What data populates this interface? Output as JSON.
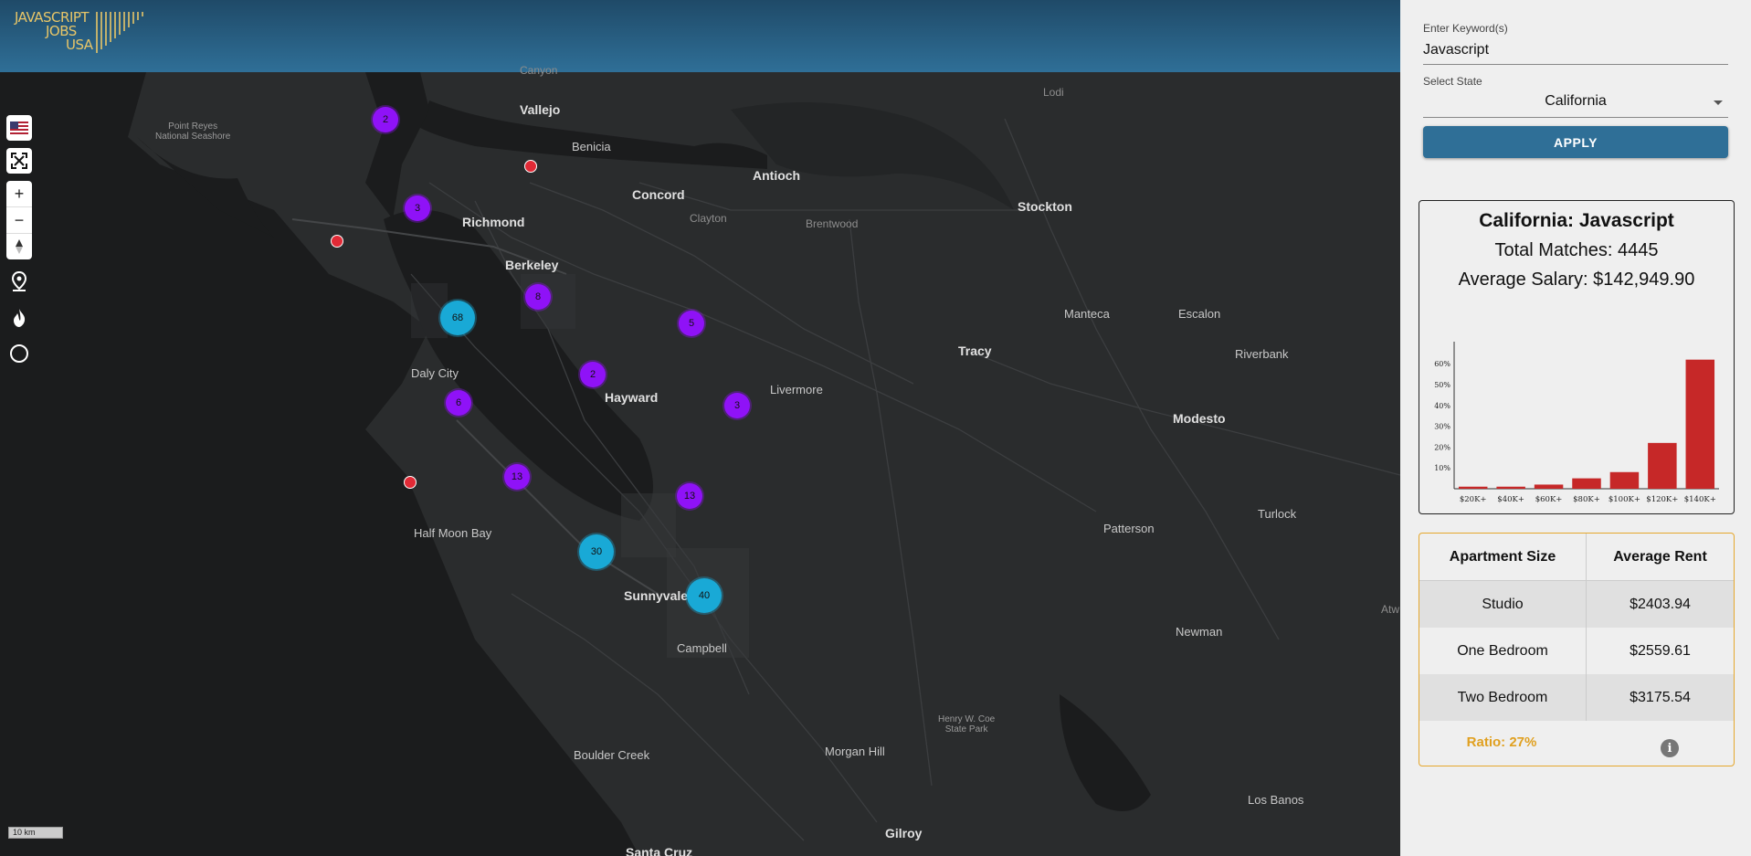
{
  "logo": {
    "line1": "JAVASCRIPT",
    "line2": "JOBS",
    "line3": "USA"
  },
  "map": {
    "places": [
      {
        "name": "Vallejo",
        "cls": "big"
      },
      {
        "name": "Benicia",
        "cls": ""
      },
      {
        "name": "Concord",
        "cls": "big"
      },
      {
        "name": "Antioch",
        "cls": "big"
      },
      {
        "name": "Clayton",
        "cls": "small"
      },
      {
        "name": "Brentwood",
        "cls": "small"
      },
      {
        "name": "Stockton",
        "cls": "big"
      },
      {
        "name": "Lodi",
        "cls": "small"
      },
      {
        "name": "Richmond",
        "cls": "big"
      },
      {
        "name": "Berkeley",
        "cls": "big"
      },
      {
        "name": "Daly City",
        "cls": ""
      },
      {
        "name": "Hayward",
        "cls": "big"
      },
      {
        "name": "Livermore",
        "cls": ""
      },
      {
        "name": "Tracy",
        "cls": "big"
      },
      {
        "name": "Manteca",
        "cls": ""
      },
      {
        "name": "Escalon",
        "cls": ""
      },
      {
        "name": "Riverbank",
        "cls": ""
      },
      {
        "name": "Modesto",
        "cls": "big"
      },
      {
        "name": "Half Moon Bay",
        "cls": ""
      },
      {
        "name": "Sunnyvale",
        "cls": "big"
      },
      {
        "name": "Campbell",
        "cls": ""
      },
      {
        "name": "Patterson",
        "cls": ""
      },
      {
        "name": "Turlock",
        "cls": ""
      },
      {
        "name": "Newman",
        "cls": ""
      },
      {
        "name": "Boulder Creek",
        "cls": ""
      },
      {
        "name": "Morgan Hill",
        "cls": ""
      },
      {
        "name": "Henry W. Coe\nState Park",
        "cls": "tiny"
      },
      {
        "name": "Los Banos",
        "cls": ""
      },
      {
        "name": "Gilroy",
        "cls": "big"
      },
      {
        "name": "Santa Cruz",
        "cls": "big"
      },
      {
        "name": "Point Reyes\nNational Seashore",
        "cls": "tiny"
      },
      {
        "name": "Canyon",
        "cls": "small"
      },
      {
        "name": "Atw",
        "cls": "small"
      }
    ],
    "clusters": [
      {
        "count": "2",
        "kind": "p"
      },
      {
        "count": "3",
        "kind": "p"
      },
      {
        "count": "8",
        "kind": "p"
      },
      {
        "count": "68",
        "kind": "c"
      },
      {
        "count": "5",
        "kind": "p"
      },
      {
        "count": "2",
        "kind": "p"
      },
      {
        "count": "6",
        "kind": "p"
      },
      {
        "count": "3",
        "kind": "p"
      },
      {
        "count": "13",
        "kind": "p"
      },
      {
        "count": "13",
        "kind": "p"
      },
      {
        "count": "30",
        "kind": "c"
      },
      {
        "count": "40",
        "kind": "c"
      }
    ],
    "scale_label": "10 km",
    "colors": {
      "cluster_small": "#8f12f7",
      "cluster_large": "#19a9d6",
      "job_pin": "#e12a36"
    }
  },
  "search": {
    "keyword_label": "Enter Keyword(s)",
    "keyword_value": "Javascript",
    "state_label": "Select State",
    "state_value": "California",
    "apply_label": "APPLY"
  },
  "summary": {
    "title": "California: Javascript",
    "total_matches": "Total Matches: 4445",
    "avg_salary": "Average Salary: $142,949.90"
  },
  "chart_data": {
    "type": "bar",
    "categories": [
      "$20K+",
      "$40K+",
      "$60K+",
      "$80K+",
      "$100K+",
      "$120K+",
      "$140K+"
    ],
    "values": [
      1,
      1,
      2,
      5,
      8,
      22,
      62
    ],
    "yticks": [
      "10%",
      "20%",
      "30%",
      "40%",
      "50%",
      "60%"
    ],
    "ylim": [
      0,
      68
    ],
    "bar_color": "#c62828"
  },
  "rent": {
    "headers": [
      "Apartment Size",
      "Average Rent"
    ],
    "rows": [
      {
        "size": "Studio",
        "rent": "$2403.94"
      },
      {
        "size": "One Bedroom",
        "rent": "$2559.61"
      },
      {
        "size": "Two Bedroom",
        "rent": "$3175.54"
      }
    ],
    "ratio": "Ratio: 27%",
    "info_glyph": "i"
  },
  "icons": {
    "flag": "flag-icon",
    "fullscreen": "fullscreen-icon",
    "zoom_in": "+",
    "zoom_out": "−",
    "compass": "compass-icon",
    "pin": "map-pin-icon",
    "heat": "flame-icon",
    "circle": "circle-icon",
    "dropdown": "chevron-down-icon"
  }
}
